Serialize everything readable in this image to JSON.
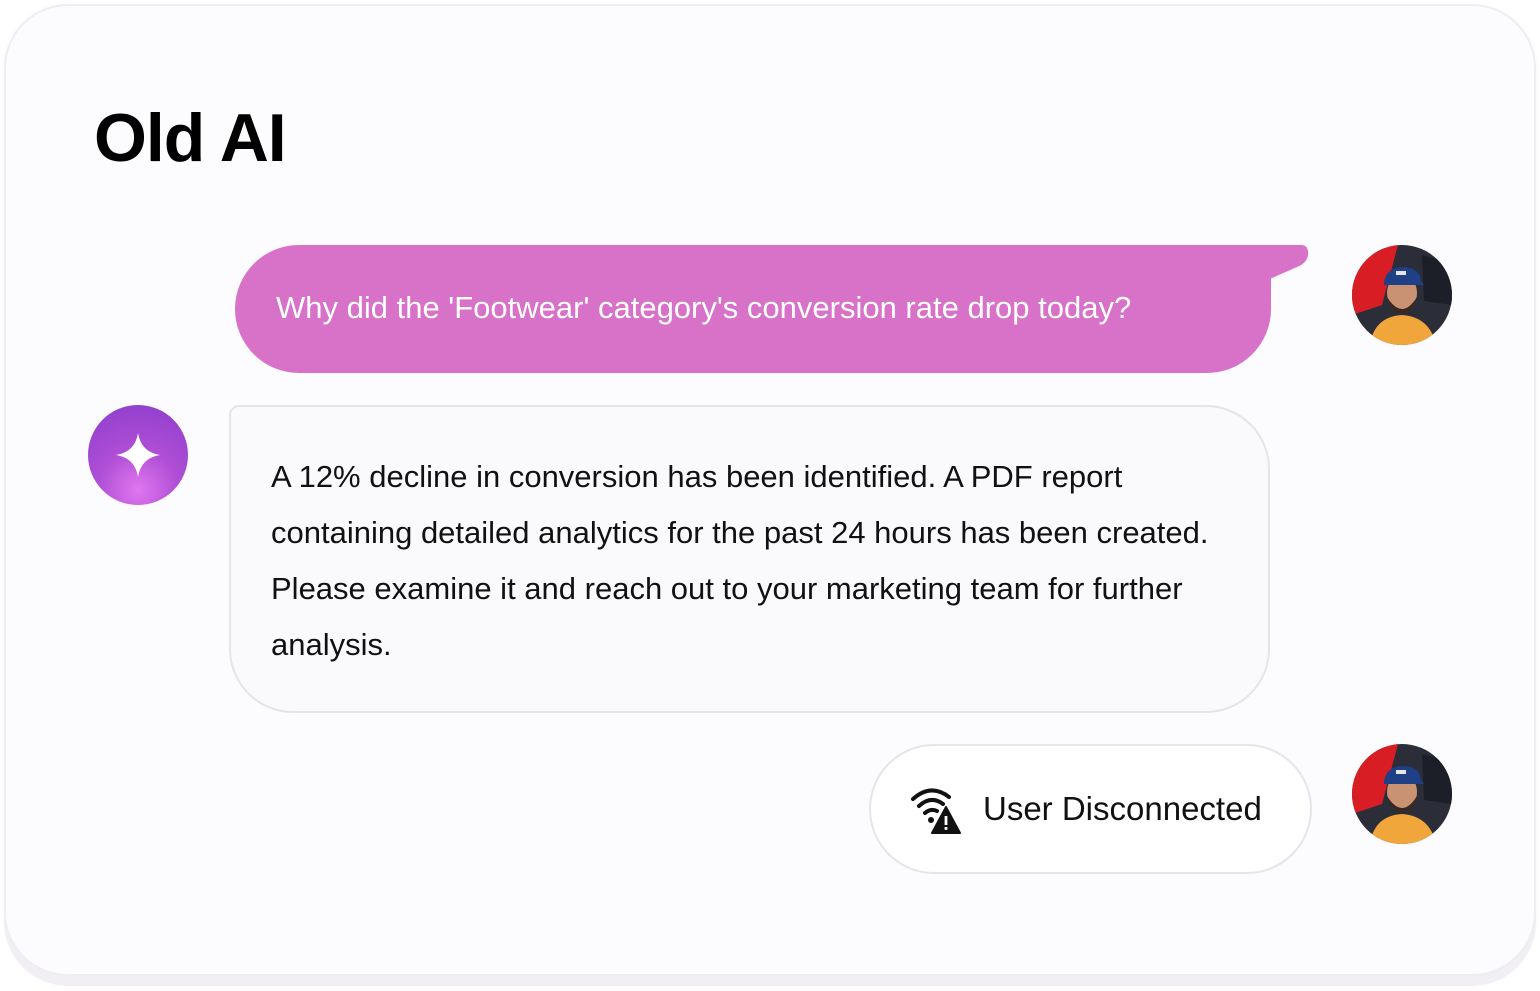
{
  "title": "Old AI",
  "conversation": {
    "user_message": "Why did the 'Footwear' category's conversion rate drop today?",
    "ai_message": "A 12% decline in conversion has been identified. A PDF report containing detailed analytics for the past 24 hours has been created. Please examine it and reach out to your marketing team for further analysis.",
    "status_message": "User Disconnected"
  },
  "icons": {
    "ai_avatar": "sparkle-icon",
    "status": "wifi-warning-icon",
    "user_avatar": "user-avatar-photo"
  },
  "colors": {
    "user_bubble": "#d872c8",
    "ai_avatar": "#a646d4",
    "card_background": "#fcfbfd"
  }
}
